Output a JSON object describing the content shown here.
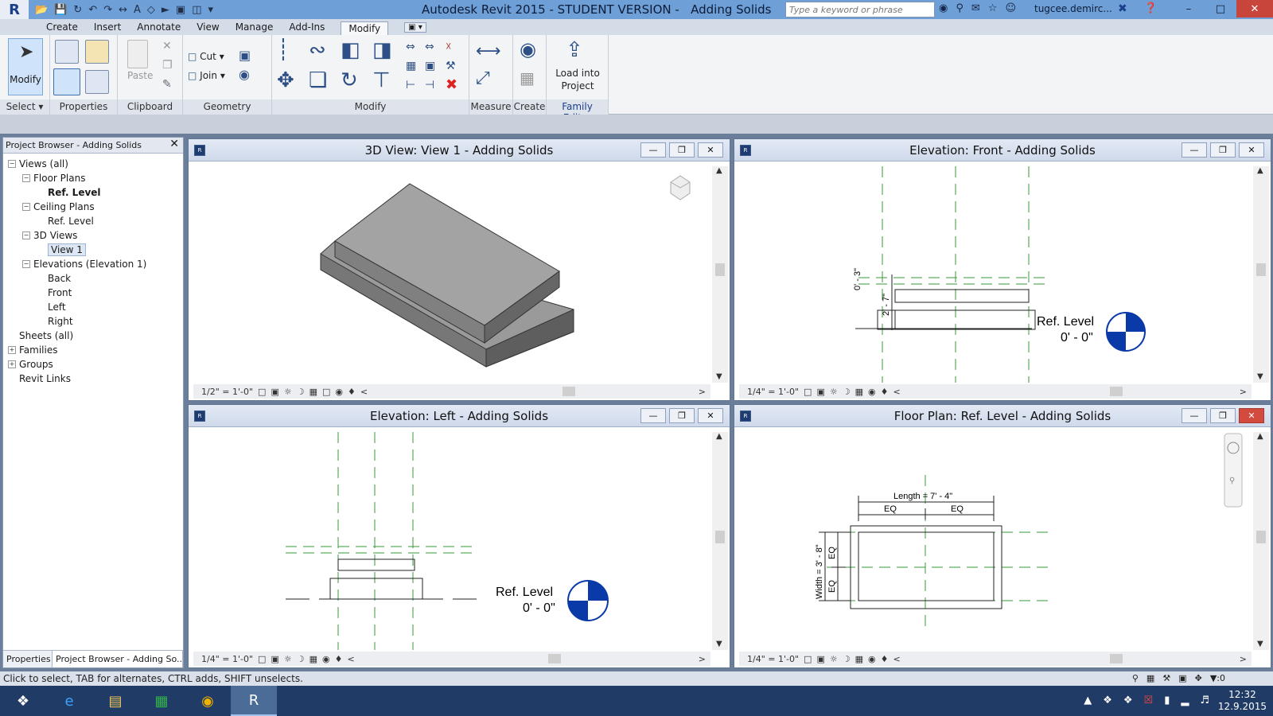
{
  "titlebar": {
    "app_title": "Autodesk Revit 2015 - STUDENT VERSION -",
    "doc_title": "Adding Solids",
    "search_placeholder": "Type a keyword or phrase",
    "user": "tugcee.demirc...",
    "min": "–",
    "max": "□",
    "close": "✕",
    "logo": "R"
  },
  "menu": {
    "tabs": [
      "Create",
      "Insert",
      "Annotate",
      "View",
      "Manage",
      "Add-Ins",
      "Modify"
    ],
    "active": "Modify"
  },
  "ribbon": {
    "modify_button": "Modify",
    "cut_label": "Cut",
    "join_label": "Join",
    "paste_label": "Paste",
    "load_into_project": "Load into Project",
    "groups": [
      "Select",
      "Properties",
      "Clipboard",
      "Geometry",
      "Modify",
      "Measure",
      "Create",
      "Family Editor"
    ]
  },
  "project_browser": {
    "title": "Project Browser - Adding Solids",
    "close": "✕",
    "items": [
      {
        "label": "Views (all)",
        "level": 0,
        "toggle": "−"
      },
      {
        "label": "Floor Plans",
        "level": 1,
        "toggle": "−"
      },
      {
        "label": "Ref. Level",
        "level": 2,
        "bold": true
      },
      {
        "label": "Ceiling Plans",
        "level": 1,
        "toggle": "−"
      },
      {
        "label": "Ref. Level",
        "level": 2
      },
      {
        "label": "3D Views",
        "level": 1,
        "toggle": "−"
      },
      {
        "label": "View 1",
        "level": 2,
        "selected": true
      },
      {
        "label": "Elevations (Elevation 1)",
        "level": 1,
        "toggle": "−"
      },
      {
        "label": "Back",
        "level": 2
      },
      {
        "label": "Front",
        "level": 2
      },
      {
        "label": "Left",
        "level": 2
      },
      {
        "label": "Right",
        "level": 2
      },
      {
        "label": "Sheets (all)",
        "level": 0
      },
      {
        "label": "Families",
        "level": 0,
        "toggle": "+"
      },
      {
        "label": "Groups",
        "level": 0,
        "toggle": "+"
      },
      {
        "label": "Revit Links",
        "level": 0
      }
    ],
    "tabs": [
      "Properties",
      "Project Browser - Adding So..."
    ]
  },
  "views": {
    "v3d": {
      "title": "3D View: View 1 - Adding Solids",
      "scale": "1/2\" = 1'-0\""
    },
    "front": {
      "title": "Elevation: Front - Adding Solids",
      "scale": "1/4\" = 1'-0\"",
      "level_name": "Ref. Level",
      "level_value": "0' - 0\"",
      "dim1": "0' - 3\"",
      "dim2": "2' - 7\""
    },
    "left": {
      "title": "Elevation: Left - Adding Solids",
      "scale": "1/4\" = 1'-0\"",
      "level_name": "Ref. Level",
      "level_value": "0' - 0\""
    },
    "plan": {
      "title": "Floor Plan: Ref. Level - Adding Solids",
      "scale": "1/4\" = 1'-0\"",
      "length": "Length = 7' - 4\"",
      "width": "Width = 3' - 8\"",
      "eq": "EQ"
    }
  },
  "status": {
    "text": "Click to select, TAB for alternates, CTRL adds, SHIFT unselects.",
    "filter_count": ":0"
  },
  "taskbar": {
    "time": "12:32",
    "date": "12.9.2015"
  },
  "colors": {
    "accent": "#6e9fd6",
    "level_marker": "#0a3aa8",
    "ref_plane": "#33a033"
  }
}
